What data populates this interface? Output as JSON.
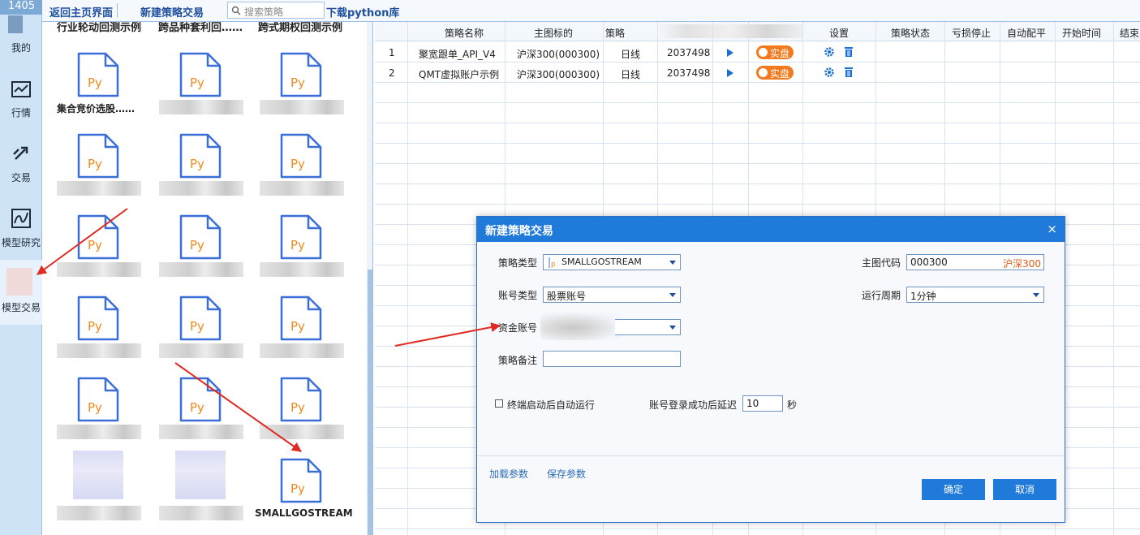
{
  "sidebar": {
    "top_label": "1405",
    "items": [
      {
        "label": "我的",
        "icon": "user-icon"
      },
      {
        "label": "行情",
        "icon": "chart-icon"
      },
      {
        "label": "交易",
        "icon": "trade-arrows-icon"
      },
      {
        "label": "模型研究",
        "icon": "model-research-icon"
      },
      {
        "label": "模型交易",
        "icon": "model-trade-icon"
      }
    ]
  },
  "toolbar": {
    "back_label": "返回主页界面",
    "new_label": "新建策略交易",
    "search_placeholder": "搜索策略",
    "download_label": "下载python库"
  },
  "library": {
    "header_captions": [
      "行业轮动回测示例",
      "跨品种套利回……",
      "跨式期权回测示例"
    ],
    "row1_caption": "集合竞价选股……",
    "icon_text": "Py",
    "last_caption": "SMALLGOSTREAM"
  },
  "grid": {
    "headers": [
      "策略名称",
      "主图标的",
      "策略",
      "设置",
      "策略状态",
      "亏损停止",
      "自动配平",
      "开始时间",
      "结束"
    ],
    "rows": [
      {
        "index": "1",
        "name": "聚宽跟单_API_V4",
        "main": "沪深300(000300)",
        "period": "日线",
        "account": "2037498",
        "mode": "实盘"
      },
      {
        "index": "2",
        "name": "QMT虚拟账户示例",
        "main": "沪深300(000300)",
        "period": "日线",
        "account": "2037498",
        "mode": "实盘"
      }
    ]
  },
  "dialog": {
    "title": "新建策略交易",
    "close": "×",
    "strategy_type_label": "策略类型",
    "strategy_type_value": "SMALLGOSTREAM",
    "account_type_label": "账号类型",
    "account_type_value": "股票账号",
    "fund_account_label": "资金账号",
    "note_label": "策略备注",
    "note_value": "",
    "main_code_label": "主图代码",
    "main_code_value": "000300",
    "main_code_name": "沪深300",
    "period_label": "运行周期",
    "period_value": "1分钟",
    "autorun_label": "终端启动后自动运行",
    "delay_label": "账号登录成功后延迟",
    "delay_value": "10",
    "delay_unit": "秒",
    "load_params": "加载参数",
    "save_params": "保存参数",
    "ok": "确定",
    "cancel": "取消"
  },
  "colors": {
    "accent": "#1f7ad9",
    "mode_badge": "#f27a1e",
    "annotation_arrow": "#e02a22",
    "py_text": "#f08a1e",
    "py_outline": "#3a6fd8"
  }
}
